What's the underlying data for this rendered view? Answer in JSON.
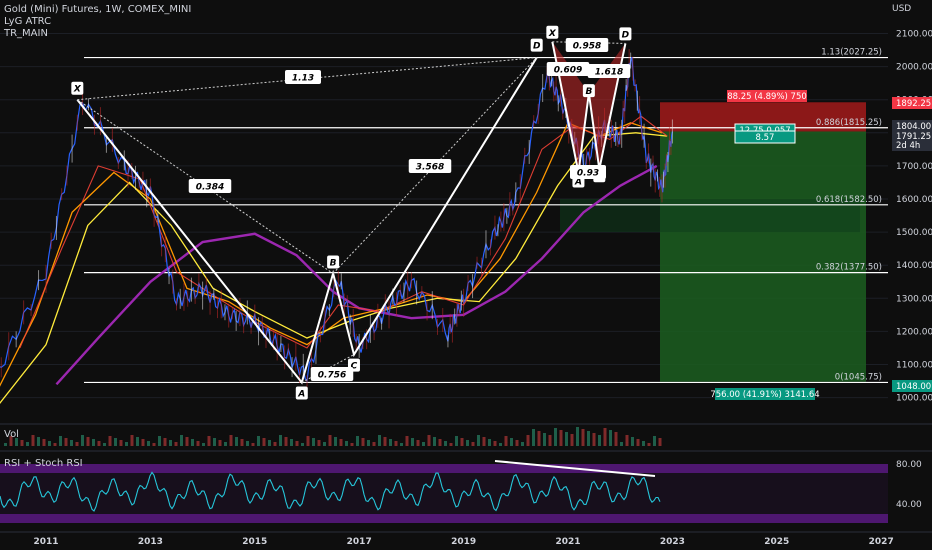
{
  "header": {
    "title": "Gold (Mini) Futures, 1W, COMEX_MINI",
    "indicator_1": "LyG ATRC",
    "indicator_2": "TR_MAIN"
  },
  "price_axis": {
    "currency": "USD",
    "ticks": [
      "2100.00",
      "2000.00",
      "1900.00",
      "1800.00",
      "1700.00",
      "1600.00",
      "1500.00",
      "1400.00",
      "1300.00",
      "1200.00",
      "1100.00",
      "1000.00"
    ],
    "badges": [
      {
        "text": "1892.25",
        "color": "#f23645"
      },
      {
        "text": "1804.00",
        "color": "#2a2e39"
      },
      {
        "text": "1791.25",
        "color": "#2a2e39"
      },
      {
        "text": "2d 4h",
        "color": "#2a2e39"
      },
      {
        "text": "1048.00",
        "color": "#089981"
      }
    ]
  },
  "time_axis": [
    "2011",
    "2013",
    "2015",
    "2017",
    "2019",
    "2021",
    "2023",
    "2025",
    "2027"
  ],
  "panels": {
    "volume_label": "Vol",
    "rsi_label": "RSI + Stoch RSI",
    "rsi_ticks": [
      "80.00",
      "40.00"
    ]
  },
  "fib_levels": [
    {
      "label": "1.13(2027.25)",
      "price": 2027.25
    },
    {
      "label": "0.886(1815.25)",
      "price": 1815.25
    },
    {
      "label": "0.618(1582.50)",
      "price": 1582.5
    },
    {
      "label": "0.382(1377.50)",
      "price": 1377.5
    },
    {
      "label": "0(1045.75)",
      "price": 1045.75
    }
  ],
  "pattern_labels": [
    "X",
    "A",
    "B",
    "C",
    "D"
  ],
  "ratio_labels": [
    "1.13",
    "0.384",
    "3.568",
    "0.756",
    "0.958",
    "0.609",
    "1.618",
    "0.93"
  ],
  "position": {
    "stop_label": "88.25 (4.89%) 750",
    "ratio_label_1": "12.75 0.057",
    "ratio_label_2": "8.57",
    "target_label": "756.00 (41.91%) 3141.64",
    "entry": 1804.0,
    "stop": 1892.25,
    "target": 1048.0
  },
  "colors": {
    "background": "#0e0e0e",
    "price_line": "#2962ff",
    "ma_purple": "#9c27b0",
    "ma_orange": "#ff9800",
    "ma_yellow": "#ffeb3b",
    "ma_red": "#f44336",
    "stop_zone": "#b71c1c",
    "target_zone": "#1b5e20",
    "rsi_line": "#26c6da",
    "rsi_band": "#6a1b9a",
    "pattern_line": "#ffffff"
  },
  "chart_data": {
    "type": "line",
    "title": "Gold (Mini) Futures, 1W, COMEX_MINI",
    "x": [
      "2010",
      "2011",
      "2011.7",
      "2012.5",
      "2013",
      "2013.5",
      "2014",
      "2014.5",
      "2015",
      "2015.5",
      "2016",
      "2016.6",
      "2017",
      "2017.5",
      "2018",
      "2018.7",
      "2019",
      "2019.6",
      "2020",
      "2020.6",
      "2020.9",
      "2021.3",
      "2021.7",
      "2022",
      "2022.2",
      "2022.5",
      "2022.8",
      "2023"
    ],
    "series": [
      {
        "values": [
          1050,
          1380,
          1900,
          1700,
          1620,
          1290,
          1330,
          1250,
          1230,
          1150,
          1065,
          1360,
          1150,
          1260,
          1350,
          1190,
          1300,
          1500,
          1600,
          1980,
          1880,
          1700,
          1820,
          1780,
          2030,
          1730,
          1630,
          1804
        ]
      }
    ],
    "ylim": [
      950,
      2150
    ],
    "xlim": [
      "2010",
      "2027.5"
    ],
    "harmonic_patterns": [
      {
        "points": {
          "X": 1900,
          "A": 1045.75,
          "B": 1375,
          "C": 1130,
          "D": 2027.25
        },
        "ratios": [
          "0.384",
          "0.756",
          "3.568",
          "1.13"
        ]
      },
      {
        "points": {
          "X": 2075,
          "A": 1680,
          "B": 1920,
          "C": 1690,
          "D": 2070
        },
        "ratios": [
          "0.609",
          "0.93",
          "1.618",
          "0.958"
        ]
      }
    ]
  }
}
